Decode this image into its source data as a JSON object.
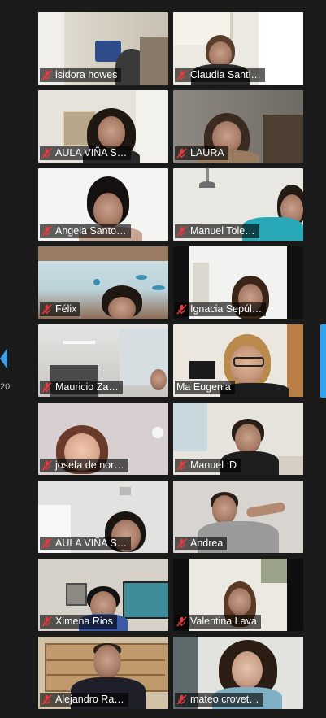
{
  "participants": [
    {
      "name": "isidora howes"
    },
    {
      "name": "Claudia Santi…"
    },
    {
      "name": "AULA VIÑA S…"
    },
    {
      "name": "LAURA"
    },
    {
      "name": "Angela Santo…"
    },
    {
      "name": "Manuel Tole…"
    },
    {
      "name": "Félix"
    },
    {
      "name": "Ignacia Sepúl…"
    },
    {
      "name": "Mauricio Za…"
    },
    {
      "name": "Ma Eugenia"
    },
    {
      "name": "josefa de nor…"
    },
    {
      "name": "Manuel :D"
    },
    {
      "name": "AULA VIÑA S…"
    },
    {
      "name": "Andrea"
    },
    {
      "name": "Ximena Rios"
    },
    {
      "name": "Valentina Lava"
    },
    {
      "name": "Alejandro Ra…"
    },
    {
      "name": "mateo crovet…"
    }
  ],
  "pagination": {
    "page_count_fragment": "20"
  },
  "icons": {
    "mute": "microphone-muted-icon",
    "prev": "previous-page-arrow-icon"
  },
  "colors": {
    "background": "#1a1a1a",
    "accent": "#31a2f0",
    "mute_icon": "#e83b3b"
  }
}
